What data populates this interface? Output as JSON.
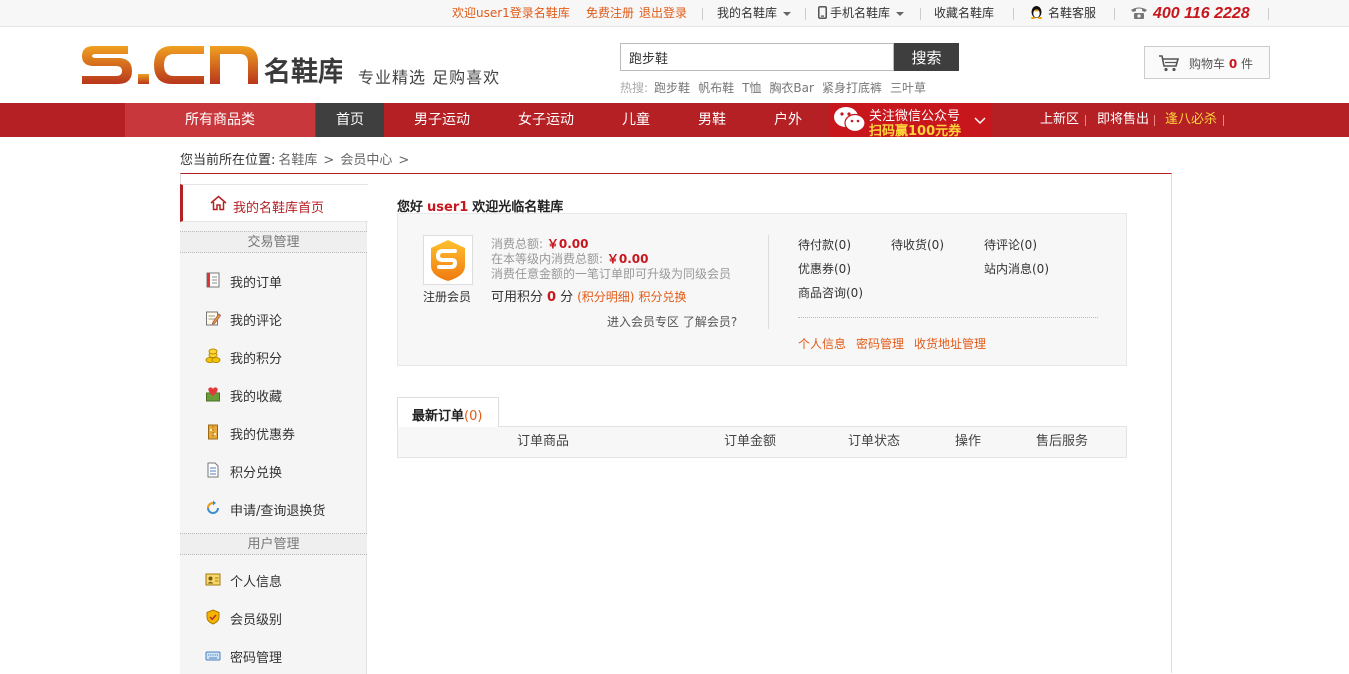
{
  "topbar": {
    "welcome": "欢迎user1登录名鞋库",
    "register": "免费注册",
    "logout": "退出登录",
    "my_account": "我的名鞋库",
    "mobile": "手机名鞋库",
    "favorite": "收藏名鞋库",
    "service": "名鞋客服",
    "phone": "400 116 2228"
  },
  "header": {
    "logo_text": "S.CN名鞋库",
    "slogan": "专业精选 足购喜欢",
    "search_value": "跑步鞋",
    "search_button": "搜索",
    "hot_label": "热搜:",
    "hot_words": [
      "跑步鞋",
      "帆布鞋",
      "T恤",
      "胸衣Bar",
      "紧身打底裤",
      "三叶草"
    ],
    "cart_label": "购物车",
    "cart_count": "0",
    "cart_unit": "件"
  },
  "nav": {
    "all_categories": "所有商品类",
    "items": [
      "首页",
      "男子运动",
      "女子运动",
      "儿童",
      "男鞋",
      "户外"
    ],
    "wechat_line1": "关注微信公众号",
    "wechat_line2": "扫码赢100元券",
    "right_items": [
      "上新区",
      "即将售出",
      "逢八必杀"
    ]
  },
  "breadcrumb": {
    "label": "您当前所在位置:",
    "items": [
      "名鞋库",
      ">",
      "会员中心",
      ">"
    ]
  },
  "sidebar": {
    "home": "我的名鞋库首页",
    "section1": "交易管理",
    "trade_items": [
      "我的订单",
      "我的评论",
      "我的积分",
      "我的收藏",
      "我的优惠券",
      "积分兑换",
      "申请/查询退换货"
    ],
    "section2": "用户管理",
    "user_items": [
      "个人信息",
      "会员级别",
      "密码管理"
    ]
  },
  "member": {
    "greeting": "您好",
    "username": "user1",
    "welcome": "欢迎光临名鞋库",
    "level": "注册会员",
    "total_label": "消费总额:",
    "total_value": "￥0.00",
    "level_total_label": "在本等级内消费总额:",
    "level_total_value": "￥0.00",
    "upgrade_note": "消费任意金额的一笔订单即可升级为同级会员",
    "points_label": "可用积分",
    "points_value": "0",
    "points_unit": "分",
    "points_detail": "(积分明细)",
    "points_exchange": "积分兑换",
    "enter_zone": "进入会员专区",
    "about_member": "了解会员?",
    "status": [
      "待付款(0)",
      "待收货(0)",
      "待评论(0)",
      "优惠券(0)",
      "站内消息(0)",
      "商品咨询(0)"
    ],
    "account_links": [
      "个人信息",
      "密码管理",
      "收货地址管理"
    ]
  },
  "orders": {
    "tab_label": "最新订单",
    "tab_count": "(0)",
    "columns": [
      "订单商品",
      "订单金额",
      "订单状态",
      "操作",
      "售后服务"
    ]
  },
  "colors": {
    "brand_red": "#b52025",
    "accent_orange": "#e25b18",
    "price_red": "#c8161d"
  }
}
